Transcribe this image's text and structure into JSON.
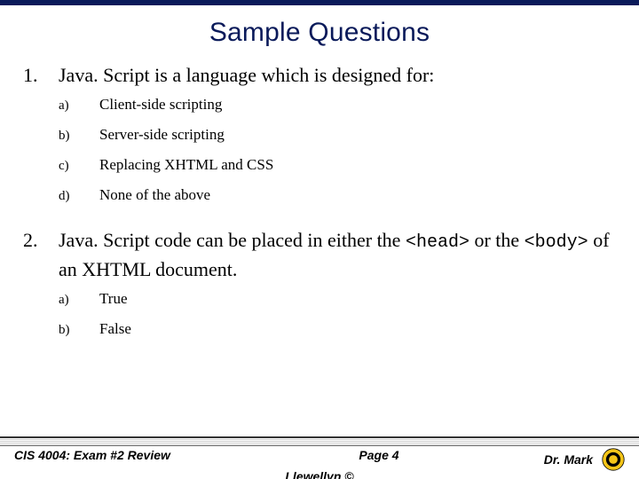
{
  "title": "Sample Questions",
  "q1": {
    "num": "1.",
    "text": "Java. Script is a language which is designed for:",
    "opts": [
      {
        "letter": "a)",
        "text": "Client-side scripting"
      },
      {
        "letter": "b)",
        "text": "Server-side scripting"
      },
      {
        "letter": "c)",
        "text": "Replacing XHTML and CSS"
      },
      {
        "letter": "d)",
        "text": "None of the above"
      }
    ]
  },
  "q2": {
    "num": "2.",
    "text_pre": "Java. Script code can be placed in either the ",
    "code1": "<head>",
    "text_mid": " or the ",
    "code2": "<body>",
    "text_post": " of an XHTML document.",
    "opts": [
      {
        "letter": "a)",
        "text": "True"
      },
      {
        "letter": "b)",
        "text": "False"
      }
    ]
  },
  "footer": {
    "left": "CIS 4004: Exam #2 Review",
    "center": "Page 4",
    "right": "Dr. Mark",
    "copy": "Llewellyn ©"
  }
}
